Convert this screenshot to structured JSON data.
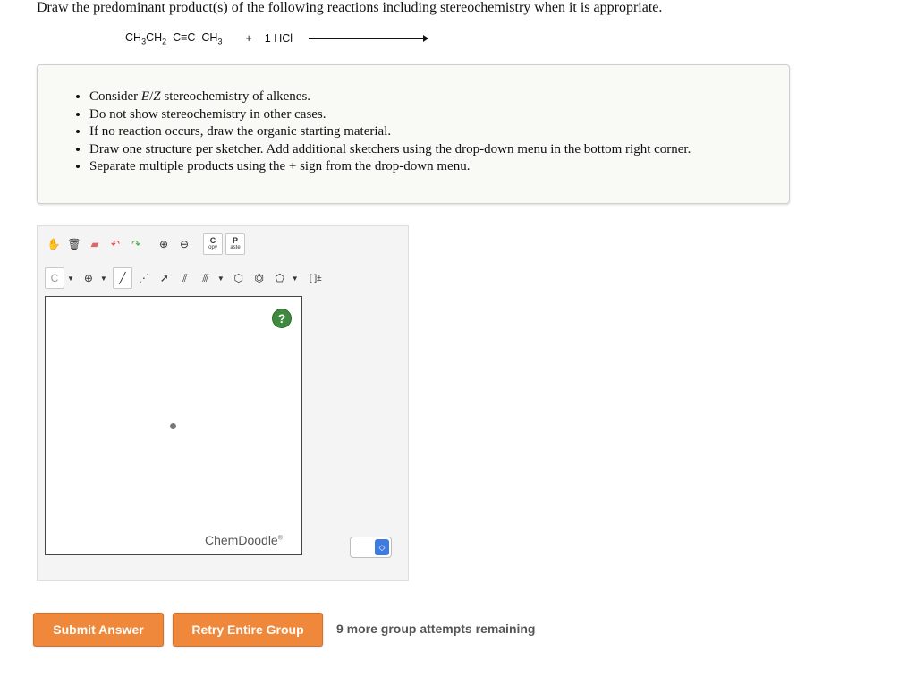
{
  "question": {
    "prompt": "Draw the predominant product(s) of the following reactions including stereochemistry when it is appropriate."
  },
  "reaction": {
    "reactant_parts": [
      "CH",
      "3",
      "CH",
      "2",
      "–C≡C–CH",
      "3"
    ],
    "plus": "+",
    "reagent": "1 HCl"
  },
  "instructions": {
    "items": [
      "Consider E/Z stereochemistry of alkenes.",
      "Do not show stereochemistry in other cases.",
      "If no reaction occurs, draw the organic starting material.",
      "Draw one structure per sketcher. Add additional sketchers using the drop-down menu in the bottom right corner.",
      "Separate multiple products using the + sign from the drop-down menu."
    ]
  },
  "sketcher": {
    "toolbar1": {
      "copy_label": "C",
      "copy_sub": "opy",
      "paste_label": "P",
      "paste_sub": "aste"
    },
    "toolbar2": {
      "element": "C",
      "charge": "⊕",
      "bracket": "[ ]±"
    },
    "help": "?",
    "brand": "ChemDoodle",
    "brand_mark": "®"
  },
  "actions": {
    "submit": "Submit Answer",
    "retry": "Retry Entire Group",
    "attempts": "9 more group attempts remaining"
  },
  "colors": {
    "accent": "#f0883b",
    "help": "#3f8a3f",
    "spinner": "#3d7be0"
  }
}
